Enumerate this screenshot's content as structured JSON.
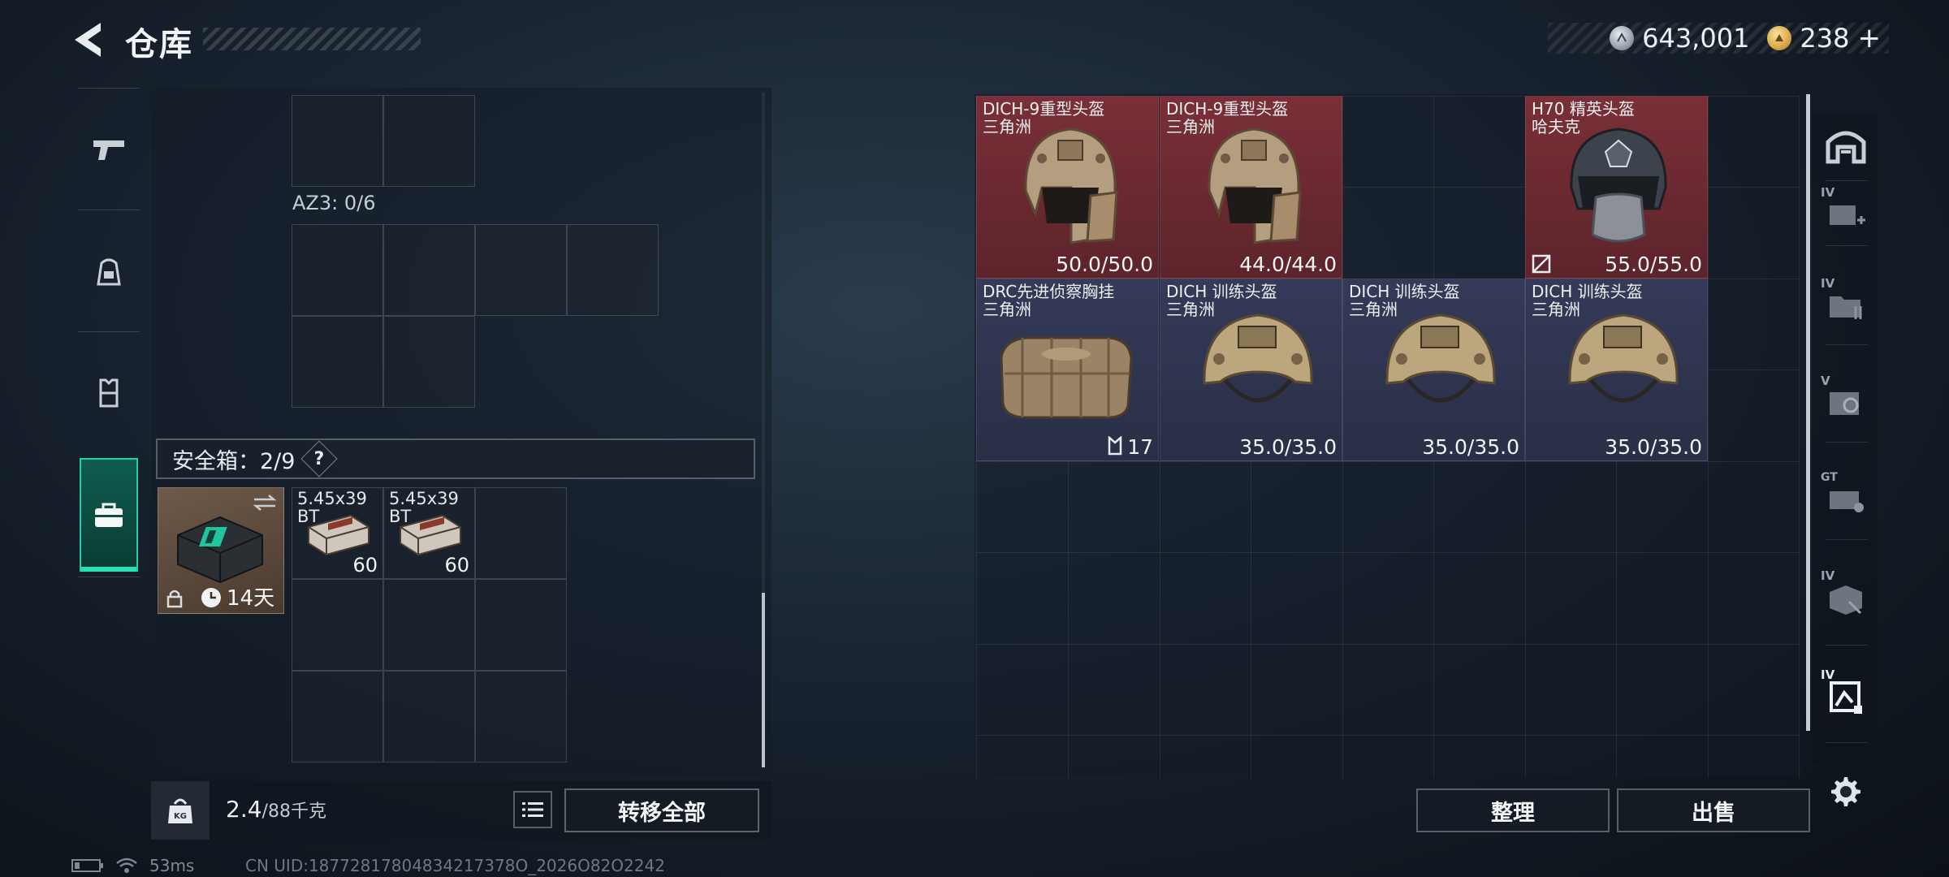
{
  "header": {
    "title": "仓库",
    "currency_silver": "643,001",
    "currency_gold": "238",
    "currency_gold_plus": "+"
  },
  "left_tabs": [
    "weapon-tab",
    "backpack-tab",
    "chest-rig-tab",
    "secure-case-tab"
  ],
  "left_panel": {
    "az3_label": "AZ3: 0/6",
    "secure_header": "安全箱：2/9",
    "secure_help": "?",
    "case_timer": "14天",
    "ammo": [
      {
        "name": "5.45x39",
        "sub": "BT",
        "count": "60"
      },
      {
        "name": "5.45x39",
        "sub": "BT",
        "count": "60"
      }
    ],
    "weight_value": "2.4",
    "weight_capacity": "/88千克",
    "weight_icon_text": "KG",
    "transfer_all": "转移全部"
  },
  "stash_items": [
    {
      "name": "DICH-9重型头盔",
      "sub": "三角洲",
      "value": "50.0/50.0",
      "rarity": "red"
    },
    {
      "name": "DICH-9重型头盔",
      "sub": "三角洲",
      "value": "44.0/44.0",
      "rarity": "red"
    },
    {
      "name": "H70 精英头盔",
      "sub": "哈夫克",
      "value": "55.0/55.0",
      "rarity": "red"
    },
    {
      "name": "DRC先进侦察胸挂",
      "sub": "三角洲",
      "value": "17",
      "rarity": "blue"
    },
    {
      "name": "DICH 训练头盔",
      "sub": "三角洲",
      "value": "35.0/35.0",
      "rarity": "blue"
    },
    {
      "name": "DICH 训练头盔",
      "sub": "三角洲",
      "value": "35.0/35.0",
      "rarity": "blue"
    },
    {
      "name": "DICH 训练头盔",
      "sub": "三角洲",
      "value": "35.0/35.0",
      "rarity": "blue"
    }
  ],
  "actions": {
    "sort": "整理",
    "sell": "出售"
  },
  "right_tabs": [
    "",
    "IV",
    "IV",
    "V",
    "GT",
    "IV",
    "IV"
  ],
  "status": {
    "ping": "53ms",
    "uid": "CN UID:18772817804834217378O_2026O82O2242"
  },
  "colors": {
    "accent": "#27e2b8",
    "red_rarity": "#6e2a33",
    "blue_rarity": "#30354f"
  }
}
